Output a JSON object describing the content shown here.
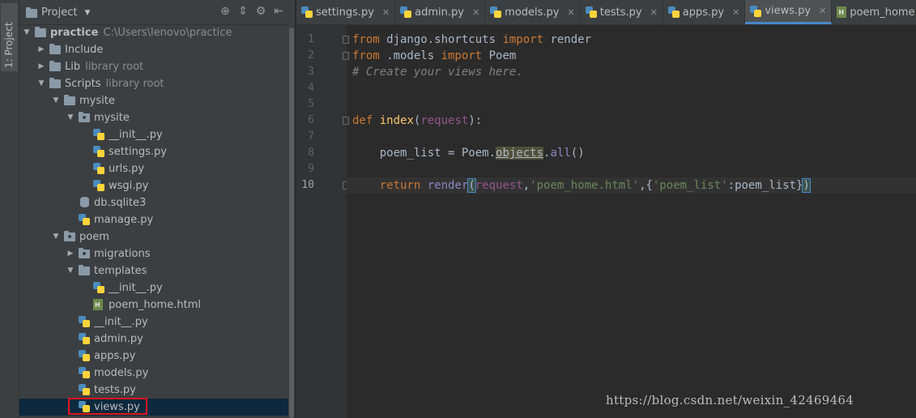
{
  "sidebar_strip": {
    "tab_label": "1: Project"
  },
  "panel": {
    "title": "Project",
    "header_icons": [
      "target-icon",
      "collapse-icon",
      "gear-icon",
      "hide-icon"
    ]
  },
  "tree": [
    {
      "label": "practice",
      "hint": "C:\\Users\\lenovo\\practice",
      "type": "folder",
      "depth": 0,
      "arrow": "down",
      "bold": true
    },
    {
      "label": "Include",
      "hint": "",
      "type": "folder",
      "depth": 1,
      "arrow": "right"
    },
    {
      "label": "Lib",
      "hint": "library root",
      "type": "folder",
      "depth": 1,
      "arrow": "right"
    },
    {
      "label": "Scripts",
      "hint": "library root",
      "type": "folder",
      "depth": 1,
      "arrow": "down"
    },
    {
      "label": "mysite",
      "hint": "",
      "type": "folder",
      "depth": 2,
      "arrow": "down"
    },
    {
      "label": "mysite",
      "hint": "",
      "type": "package",
      "depth": 3,
      "arrow": "down"
    },
    {
      "label": "__init__.py",
      "hint": "",
      "type": "python",
      "depth": 4,
      "arrow": ""
    },
    {
      "label": "settings.py",
      "hint": "",
      "type": "python",
      "depth": 4,
      "arrow": ""
    },
    {
      "label": "urls.py",
      "hint": "",
      "type": "python",
      "depth": 4,
      "arrow": ""
    },
    {
      "label": "wsgi.py",
      "hint": "",
      "type": "python",
      "depth": 4,
      "arrow": ""
    },
    {
      "label": "db.sqlite3",
      "hint": "",
      "type": "database",
      "depth": 3,
      "arrow": ""
    },
    {
      "label": "manage.py",
      "hint": "",
      "type": "python",
      "depth": 3,
      "arrow": ""
    },
    {
      "label": "poem",
      "hint": "",
      "type": "package",
      "depth": 2,
      "arrow": "down"
    },
    {
      "label": "migrations",
      "hint": "",
      "type": "package",
      "depth": 3,
      "arrow": "right"
    },
    {
      "label": "templates",
      "hint": "",
      "type": "folder",
      "depth": 3,
      "arrow": "down"
    },
    {
      "label": "__init__.py",
      "hint": "",
      "type": "python",
      "depth": 4,
      "arrow": ""
    },
    {
      "label": "poem_home.html",
      "hint": "",
      "type": "html",
      "depth": 4,
      "arrow": ""
    },
    {
      "label": "__init__.py",
      "hint": "",
      "type": "python",
      "depth": 3,
      "arrow": ""
    },
    {
      "label": "admin.py",
      "hint": "",
      "type": "python",
      "depth": 3,
      "arrow": ""
    },
    {
      "label": "apps.py",
      "hint": "",
      "type": "python",
      "depth": 3,
      "arrow": ""
    },
    {
      "label": "models.py",
      "hint": "",
      "type": "python",
      "depth": 3,
      "arrow": ""
    },
    {
      "label": "tests.py",
      "hint": "",
      "type": "python",
      "depth": 3,
      "arrow": ""
    },
    {
      "label": "views.py",
      "hint": "",
      "type": "python",
      "depth": 3,
      "arrow": "",
      "selected": true
    }
  ],
  "tabs": [
    {
      "label": "settings.py",
      "icon": "python-file-icon",
      "active": false
    },
    {
      "label": "admin.py",
      "icon": "python-file-icon",
      "active": false
    },
    {
      "label": "models.py",
      "icon": "python-file-icon",
      "active": false
    },
    {
      "label": "tests.py",
      "icon": "python-file-icon",
      "active": false
    },
    {
      "label": "apps.py",
      "icon": "python-file-icon",
      "active": false
    },
    {
      "label": "views.py",
      "icon": "python-file-icon",
      "active": true
    },
    {
      "label": "poem_home.html",
      "icon": "html-file-icon",
      "active": false
    }
  ],
  "editor": {
    "current_line": 10,
    "lines": [
      [
        {
          "t": "kw",
          "s": "from"
        },
        {
          "t": "",
          "s": " django.shortcuts "
        },
        {
          "t": "kw",
          "s": "import"
        },
        {
          "t": "",
          "s": " render"
        }
      ],
      [
        {
          "t": "kw",
          "s": "from"
        },
        {
          "t": "",
          "s": " .models "
        },
        {
          "t": "kw",
          "s": "import"
        },
        {
          "t": "",
          "s": " Poem"
        }
      ],
      [
        {
          "t": "cm",
          "s": "# Create your views here."
        }
      ],
      [],
      [],
      [
        {
          "t": "kw",
          "s": "def"
        },
        {
          "t": "",
          "s": " "
        },
        {
          "t": "fn",
          "s": "index"
        },
        {
          "t": "",
          "s": "("
        },
        {
          "t": "pa",
          "s": "request"
        },
        {
          "t": "",
          "s": "):"
        }
      ],
      [],
      [
        {
          "t": "",
          "s": "    poem_list = Poem."
        },
        {
          "t": "hl",
          "s": "objects"
        },
        {
          "t": "",
          "s": "."
        },
        {
          "t": "bi",
          "s": "all"
        },
        {
          "t": "",
          "s": "()"
        }
      ],
      [],
      [
        {
          "t": "",
          "s": "    "
        },
        {
          "t": "kw",
          "s": "return"
        },
        {
          "t": "",
          "s": " "
        },
        {
          "t": "bi",
          "s": "render"
        },
        {
          "t": "brk",
          "s": "("
        },
        {
          "t": "pa",
          "s": "request"
        },
        {
          "t": "",
          "s": ","
        },
        {
          "t": "st",
          "s": "'poem_home.html'"
        },
        {
          "t": "",
          "s": ",{"
        },
        {
          "t": "st",
          "s": "'poem_list'"
        },
        {
          "t": "",
          "s": ":poem_list}"
        },
        {
          "t": "brk",
          "s": ")"
        }
      ]
    ],
    "fold_markers_on_lines": [
      1,
      2,
      6,
      10
    ]
  },
  "watermark": "https://blog.csdn.net/weixin_42469464",
  "colors": {
    "background": "#2b2b2b",
    "panel": "#3c3f41",
    "keyword": "#cc7832",
    "string": "#6a8759",
    "comment": "#808080",
    "function": "#ffc66d",
    "selection_box": "#e0141e",
    "active_tab_underline": "#4a88c7"
  }
}
